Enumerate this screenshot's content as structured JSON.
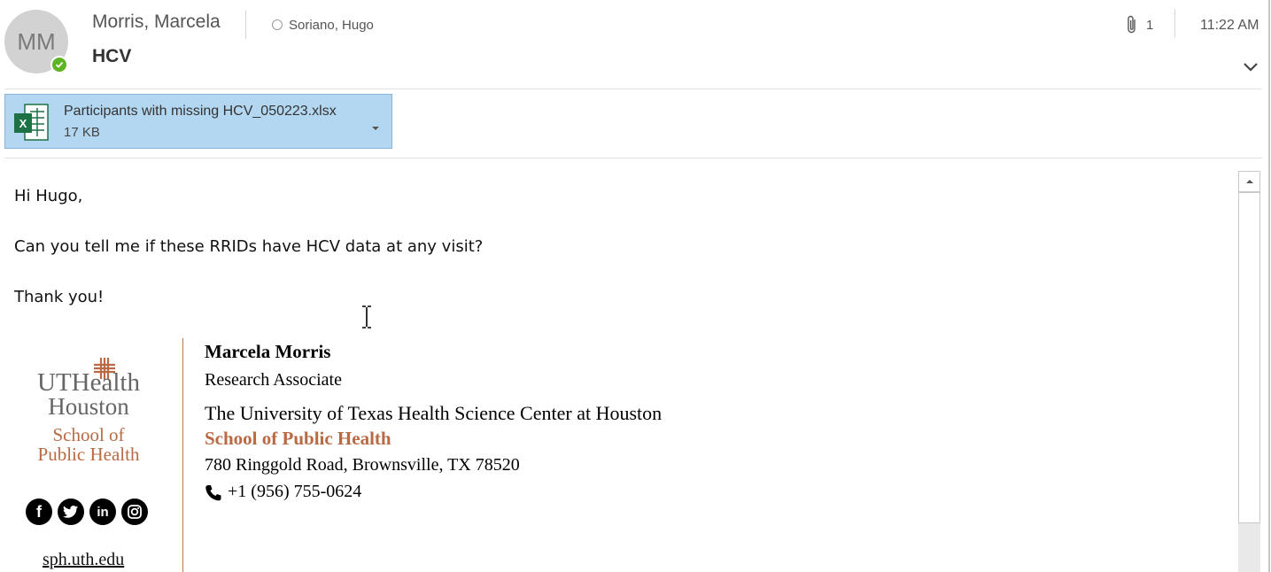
{
  "header": {
    "avatar_initials": "MM",
    "sender": "Morris, Marcela",
    "recipient": "Soriano, Hugo",
    "subject": "HCV",
    "attachment_count": "1",
    "time": "11:22 AM",
    "presence_color": "#5db425"
  },
  "attachment": {
    "file_name": "Participants with missing HCV_050223.xlsx",
    "file_size": "17 KB",
    "icon": "excel-file-icon",
    "bg_color": "#b3d7f1"
  },
  "message": {
    "greeting": "Hi Hugo,",
    "body": "Can you tell me if these RRIDs have HCV data at any visit?",
    "closing": "Thank you!"
  },
  "signature": {
    "logo_line1": "UTHealth",
    "logo_line2": "Houston",
    "logo_line3": "School of",
    "logo_line4": "Public Health",
    "name": "Marcela Morris",
    "title": "Research Associate",
    "org": "The University of Texas Health Science Center at Houston",
    "school": "School of Public Health",
    "address": "780 Ringgold Road, Brownsville, TX 78520",
    "phone": "+1 (956) 755-0624",
    "website": "sph.uth.edu",
    "social": [
      "f",
      "t",
      "in",
      "ig"
    ],
    "accent_color": "#b86a44"
  }
}
